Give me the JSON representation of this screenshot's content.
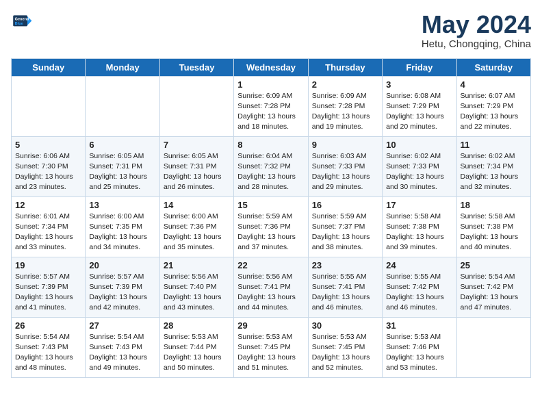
{
  "header": {
    "logo_line1": "General",
    "logo_line2": "Blue",
    "month": "May 2024",
    "location": "Hetu, Chongqing, China"
  },
  "weekdays": [
    "Sunday",
    "Monday",
    "Tuesday",
    "Wednesday",
    "Thursday",
    "Friday",
    "Saturday"
  ],
  "weeks": [
    [
      {
        "day": "",
        "info": ""
      },
      {
        "day": "",
        "info": ""
      },
      {
        "day": "",
        "info": ""
      },
      {
        "day": "1",
        "info": "Sunrise: 6:09 AM\nSunset: 7:28 PM\nDaylight: 13 hours\nand 18 minutes."
      },
      {
        "day": "2",
        "info": "Sunrise: 6:09 AM\nSunset: 7:28 PM\nDaylight: 13 hours\nand 19 minutes."
      },
      {
        "day": "3",
        "info": "Sunrise: 6:08 AM\nSunset: 7:29 PM\nDaylight: 13 hours\nand 20 minutes."
      },
      {
        "day": "4",
        "info": "Sunrise: 6:07 AM\nSunset: 7:29 PM\nDaylight: 13 hours\nand 22 minutes."
      }
    ],
    [
      {
        "day": "5",
        "info": "Sunrise: 6:06 AM\nSunset: 7:30 PM\nDaylight: 13 hours\nand 23 minutes."
      },
      {
        "day": "6",
        "info": "Sunrise: 6:05 AM\nSunset: 7:31 PM\nDaylight: 13 hours\nand 25 minutes."
      },
      {
        "day": "7",
        "info": "Sunrise: 6:05 AM\nSunset: 7:31 PM\nDaylight: 13 hours\nand 26 minutes."
      },
      {
        "day": "8",
        "info": "Sunrise: 6:04 AM\nSunset: 7:32 PM\nDaylight: 13 hours\nand 28 minutes."
      },
      {
        "day": "9",
        "info": "Sunrise: 6:03 AM\nSunset: 7:33 PM\nDaylight: 13 hours\nand 29 minutes."
      },
      {
        "day": "10",
        "info": "Sunrise: 6:02 AM\nSunset: 7:33 PM\nDaylight: 13 hours\nand 30 minutes."
      },
      {
        "day": "11",
        "info": "Sunrise: 6:02 AM\nSunset: 7:34 PM\nDaylight: 13 hours\nand 32 minutes."
      }
    ],
    [
      {
        "day": "12",
        "info": "Sunrise: 6:01 AM\nSunset: 7:34 PM\nDaylight: 13 hours\nand 33 minutes."
      },
      {
        "day": "13",
        "info": "Sunrise: 6:00 AM\nSunset: 7:35 PM\nDaylight: 13 hours\nand 34 minutes."
      },
      {
        "day": "14",
        "info": "Sunrise: 6:00 AM\nSunset: 7:36 PM\nDaylight: 13 hours\nand 35 minutes."
      },
      {
        "day": "15",
        "info": "Sunrise: 5:59 AM\nSunset: 7:36 PM\nDaylight: 13 hours\nand 37 minutes."
      },
      {
        "day": "16",
        "info": "Sunrise: 5:59 AM\nSunset: 7:37 PM\nDaylight: 13 hours\nand 38 minutes."
      },
      {
        "day": "17",
        "info": "Sunrise: 5:58 AM\nSunset: 7:38 PM\nDaylight: 13 hours\nand 39 minutes."
      },
      {
        "day": "18",
        "info": "Sunrise: 5:58 AM\nSunset: 7:38 PM\nDaylight: 13 hours\nand 40 minutes."
      }
    ],
    [
      {
        "day": "19",
        "info": "Sunrise: 5:57 AM\nSunset: 7:39 PM\nDaylight: 13 hours\nand 41 minutes."
      },
      {
        "day": "20",
        "info": "Sunrise: 5:57 AM\nSunset: 7:39 PM\nDaylight: 13 hours\nand 42 minutes."
      },
      {
        "day": "21",
        "info": "Sunrise: 5:56 AM\nSunset: 7:40 PM\nDaylight: 13 hours\nand 43 minutes."
      },
      {
        "day": "22",
        "info": "Sunrise: 5:56 AM\nSunset: 7:41 PM\nDaylight: 13 hours\nand 44 minutes."
      },
      {
        "day": "23",
        "info": "Sunrise: 5:55 AM\nSunset: 7:41 PM\nDaylight: 13 hours\nand 46 minutes."
      },
      {
        "day": "24",
        "info": "Sunrise: 5:55 AM\nSunset: 7:42 PM\nDaylight: 13 hours\nand 46 minutes."
      },
      {
        "day": "25",
        "info": "Sunrise: 5:54 AM\nSunset: 7:42 PM\nDaylight: 13 hours\nand 47 minutes."
      }
    ],
    [
      {
        "day": "26",
        "info": "Sunrise: 5:54 AM\nSunset: 7:43 PM\nDaylight: 13 hours\nand 48 minutes."
      },
      {
        "day": "27",
        "info": "Sunrise: 5:54 AM\nSunset: 7:43 PM\nDaylight: 13 hours\nand 49 minutes."
      },
      {
        "day": "28",
        "info": "Sunrise: 5:53 AM\nSunset: 7:44 PM\nDaylight: 13 hours\nand 50 minutes."
      },
      {
        "day": "29",
        "info": "Sunrise: 5:53 AM\nSunset: 7:45 PM\nDaylight: 13 hours\nand 51 minutes."
      },
      {
        "day": "30",
        "info": "Sunrise: 5:53 AM\nSunset: 7:45 PM\nDaylight: 13 hours\nand 52 minutes."
      },
      {
        "day": "31",
        "info": "Sunrise: 5:53 AM\nSunset: 7:46 PM\nDaylight: 13 hours\nand 53 minutes."
      },
      {
        "day": "",
        "info": ""
      }
    ]
  ]
}
